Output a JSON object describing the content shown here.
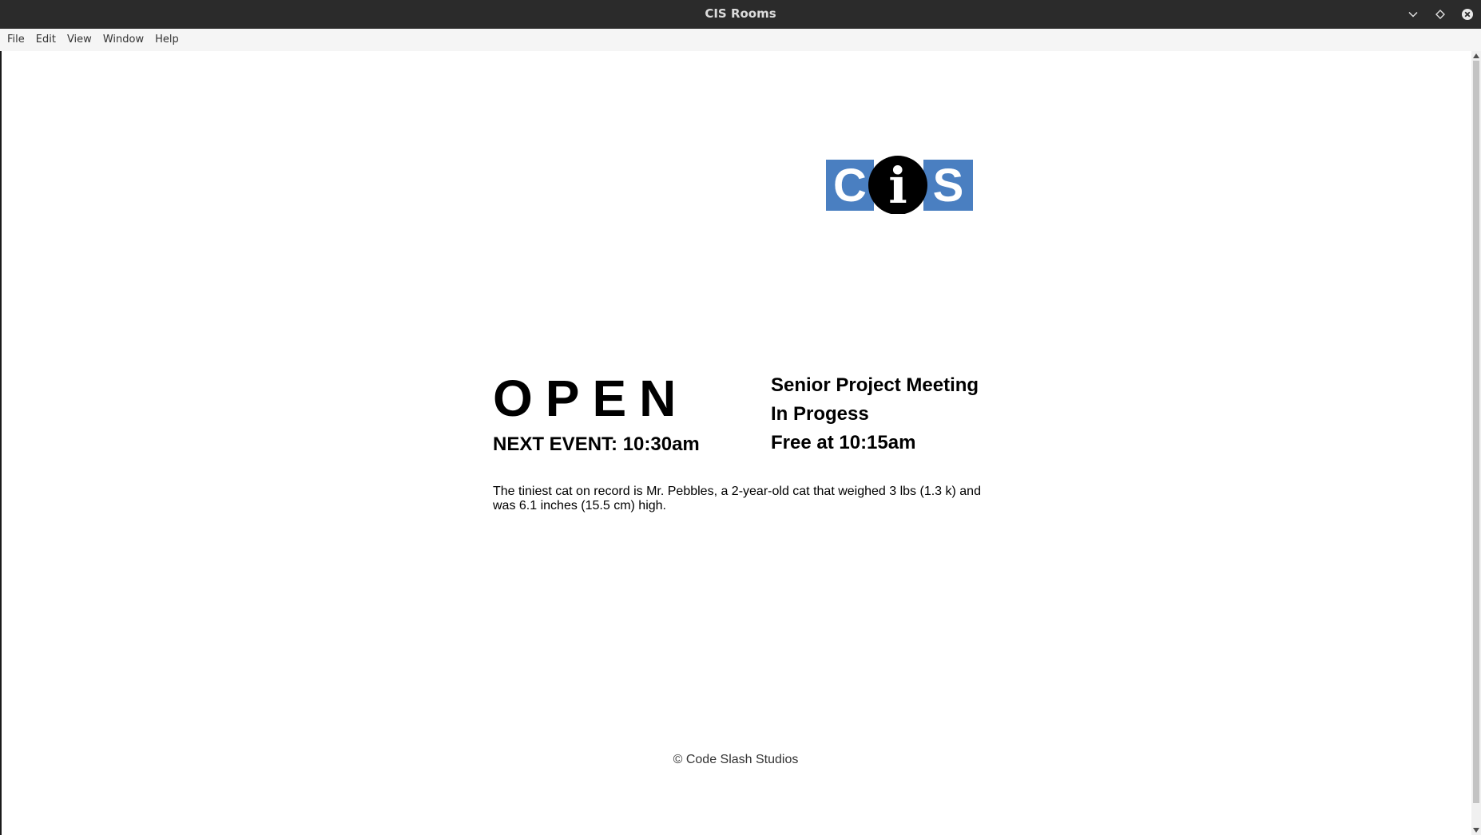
{
  "window": {
    "title": "CIS Rooms",
    "controls": {
      "minimize_icon": "chevron-down-icon",
      "maximize_icon": "diamond-icon",
      "close_icon": "close-icon"
    }
  },
  "menubar": {
    "items": [
      {
        "label": "File"
      },
      {
        "label": "Edit"
      },
      {
        "label": "View"
      },
      {
        "label": "Window"
      },
      {
        "label": "Help"
      }
    ]
  },
  "logo": {
    "letters": [
      "C",
      "i",
      "S"
    ],
    "colors": {
      "box": "#4a7fc1",
      "circle": "#000000",
      "text": "#ffffff"
    }
  },
  "room": {
    "status": "OPEN",
    "next_event": "NEXT EVENT: 10:30am",
    "current_event": {
      "name": "Senior Project Meeting",
      "state": "In Progess",
      "free_at": "Free at 10:15am"
    },
    "fact": "The tiniest cat on record is Mr. Pebbles, a 2-year-old cat that weighed 3 lbs (1.3 k) and was 6.1 inches (15.5 cm) high."
  },
  "footer": {
    "copyright": "© Code Slash Studios"
  }
}
